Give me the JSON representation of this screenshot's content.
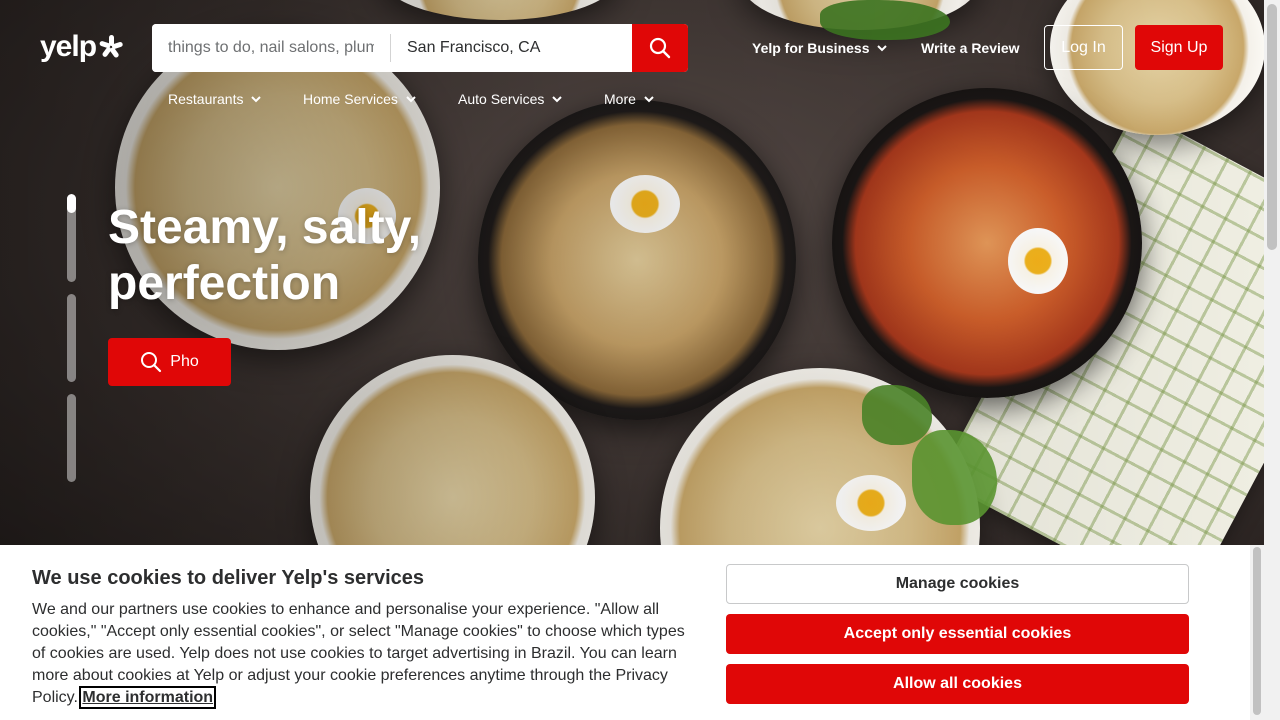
{
  "header": {
    "logo_text": "yelp",
    "search_what_placeholder": "things to do, nail salons, plumbers",
    "search_where_value": "San Francisco, CA",
    "yelp_for_business": "Yelp for Business",
    "write_review": "Write a Review",
    "login": "Log In",
    "signup": "Sign Up"
  },
  "categories": [
    {
      "label": "Restaurants"
    },
    {
      "label": "Home Services"
    },
    {
      "label": "Auto Services"
    },
    {
      "label": "More"
    }
  ],
  "hero": {
    "headline_line1": "Steamy, salty,",
    "headline_line2": "perfection",
    "cta_label": "Pho",
    "carousel_active_index": 0,
    "carousel_active_progress": 0.22
  },
  "cookie": {
    "title": "We use cookies to deliver Yelp's services",
    "body": "We and our partners use cookies to enhance and personalise your experience. \"Allow all cookies,\" \"Accept only essential cookies\", or select \"Manage cookies\" to choose which types of cookies are used. Yelp does not use cookies to target advertising in Brazil. You can learn more about cookies at Yelp or adjust your cookie preferences anytime through the Privacy Policy.",
    "more_info": "More information",
    "manage": "Manage cookies",
    "essential": "Accept only essential cookies",
    "allow_all": "Allow all cookies"
  },
  "colors": {
    "brand_red": "#e00707",
    "text_dark": "#2d2e2f"
  }
}
